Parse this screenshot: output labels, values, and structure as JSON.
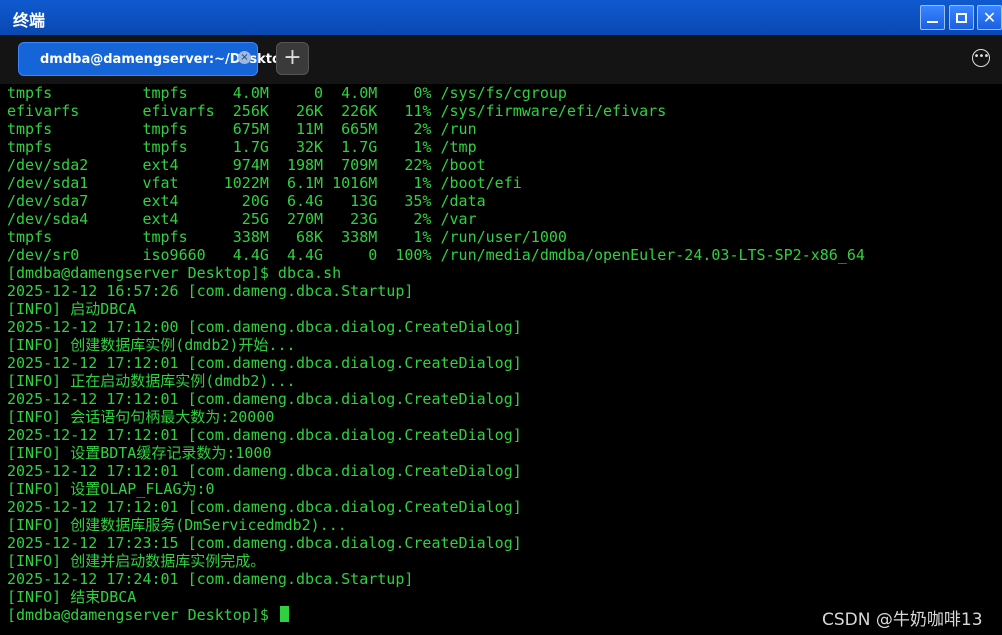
{
  "window": {
    "title": "终端",
    "minimize_icon": "minimize-icon",
    "maximize_icon": "maximize-icon",
    "close_icon": "close-icon"
  },
  "tabs": {
    "items": [
      {
        "label": "dmdba@damengserver:~/Desktop"
      }
    ],
    "add_label": "+"
  },
  "terminal": {
    "lines": [
      "tmpfs          tmpfs     4.0M     0  4.0M    0% /sys/fs/cgroup",
      "efivarfs       efivarfs  256K   26K  226K   11% /sys/firmware/efi/efivars",
      "tmpfs          tmpfs     675M   11M  665M    2% /run",
      "tmpfs          tmpfs     1.7G   32K  1.7G    1% /tmp",
      "/dev/sda2      ext4      974M  198M  709M   22% /boot",
      "/dev/sda1      vfat     1022M  6.1M 1016M    1% /boot/efi",
      "/dev/sda7      ext4       20G  6.4G   13G   35% /data",
      "/dev/sda4      ext4       25G  270M   23G    2% /var",
      "tmpfs          tmpfs     338M   68K  338M    1% /run/user/1000",
      "/dev/sr0       iso9660   4.4G  4.4G     0  100% /run/media/dmdba/openEuler-24.03-LTS-SP2-x86_64",
      "[dmdba@damengserver Desktop]$ dbca.sh",
      "2025-12-12 16:57:26 [com.dameng.dbca.Startup]",
      "[INFO] 启动DBCA",
      "2025-12-12 17:12:00 [com.dameng.dbca.dialog.CreateDialog]",
      "[INFO] 创建数据库实例(dmdb2)开始...",
      "2025-12-12 17:12:01 [com.dameng.dbca.dialog.CreateDialog]",
      "[INFO] 正在启动数据库实例(dmdb2)...",
      "2025-12-12 17:12:01 [com.dameng.dbca.dialog.CreateDialog]",
      "[INFO] 会话语句句柄最大数为:20000",
      "2025-12-12 17:12:01 [com.dameng.dbca.dialog.CreateDialog]",
      "[INFO] 设置BDTA缓存记录数为:1000",
      "2025-12-12 17:12:01 [com.dameng.dbca.dialog.CreateDialog]",
      "[INFO] 设置OLAP_FLAG为:0",
      "2025-12-12 17:12:01 [com.dameng.dbca.dialog.CreateDialog]",
      "[INFO] 创建数据库服务(DmServicedmdb2)...",
      "2025-12-12 17:23:15 [com.dameng.dbca.dialog.CreateDialog]",
      "[INFO] 创建并启动数据库实例完成。",
      "2025-12-12 17:24:01 [com.dameng.dbca.Startup]",
      "[INFO] 结束DBCA"
    ],
    "prompt": "[dmdba@damengserver Desktop]$ "
  },
  "watermark": "CSDN @牛奶咖啡13",
  "colors": {
    "terminal_text": "#2fd23e",
    "titlebar": "#0f5ad0",
    "tab_active": "#1565d8"
  }
}
